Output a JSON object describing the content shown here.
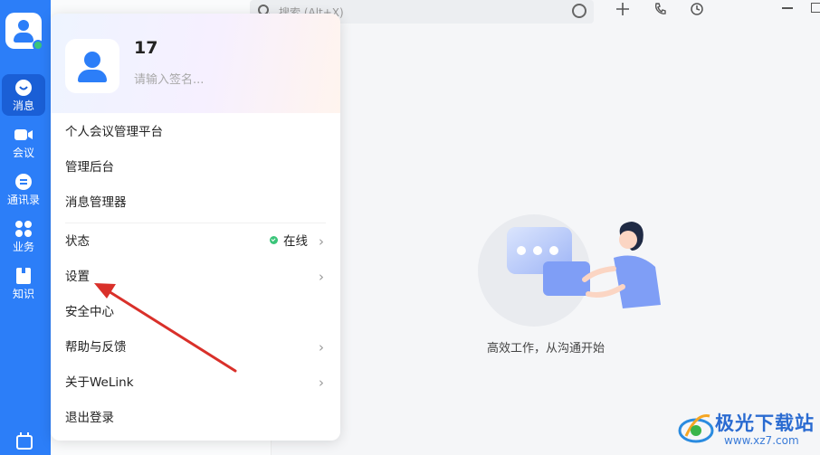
{
  "nav": {
    "items": [
      {
        "label": "消息",
        "icon": "chat-bubble-icon",
        "active": true
      },
      {
        "label": "会议",
        "icon": "video-camera-icon",
        "active": false
      },
      {
        "label": "通讯录",
        "icon": "contacts-icon",
        "active": false
      },
      {
        "label": "业务",
        "icon": "apps-grid-icon",
        "active": false
      },
      {
        "label": "知识",
        "icon": "book-icon",
        "active": false
      }
    ]
  },
  "search": {
    "placeholder": "搜索 (Alt+X)"
  },
  "profile": {
    "name": "17",
    "signature_placeholder": "请输入签名..."
  },
  "menu": {
    "personal_meeting": "个人会议管理平台",
    "admin_backend": "管理后台",
    "message_manager": "消息管理器",
    "status_label": "状态",
    "status_value": "在线",
    "settings": "设置",
    "security_center": "安全中心",
    "help_feedback": "帮助与反馈",
    "about": "关于WeLink",
    "logout": "退出登录"
  },
  "main": {
    "empty_text": "高效工作，从沟通开始"
  },
  "watermark": {
    "brand": "极光下载站",
    "url": "www.xz7.com"
  },
  "colors": {
    "accent": "#2c7ef8",
    "annotation_arrow": "#d9302a",
    "online": "#3bc57a"
  }
}
